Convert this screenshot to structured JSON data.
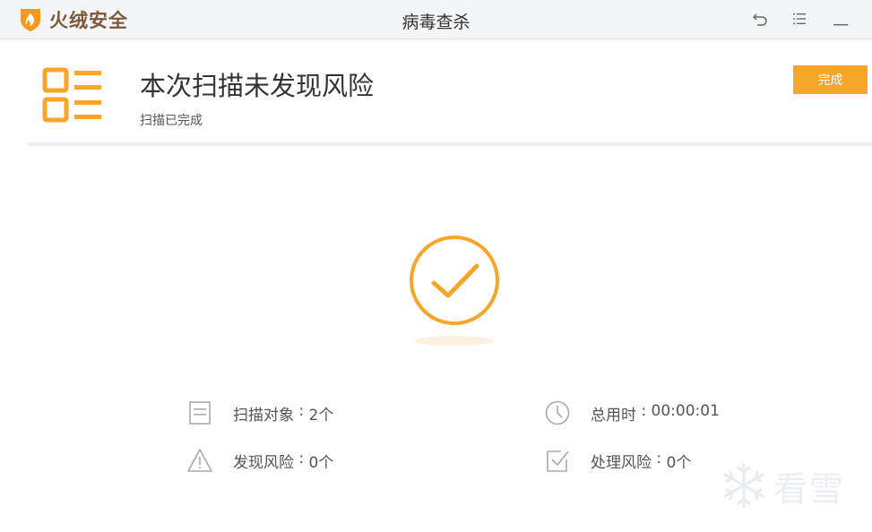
{
  "app": {
    "logo_text": "火绒安全",
    "window_title": "病毒查杀"
  },
  "titlebar": {
    "back_icon": "undo-icon",
    "menu_icon": "list-icon",
    "minimize_icon": "minimize-icon"
  },
  "header": {
    "headline": "本次扫描未发现风险",
    "subline": "扫描已完成",
    "done_label": "完成"
  },
  "stats": {
    "objects": {
      "label": "扫描对象",
      "value": "2个"
    },
    "risks": {
      "label": "发现风险",
      "value": "0个"
    },
    "time": {
      "label": "总用时",
      "value": "00:00:01"
    },
    "handled": {
      "label": "处理风险",
      "value": "0个"
    },
    "separator": " : "
  },
  "watermark": {
    "text": "看雪"
  },
  "colors": {
    "accent": "#f8a629",
    "titlebar_bg": "#f4f5f6",
    "text": "#333333",
    "icon_gray": "#aaaaaa"
  }
}
